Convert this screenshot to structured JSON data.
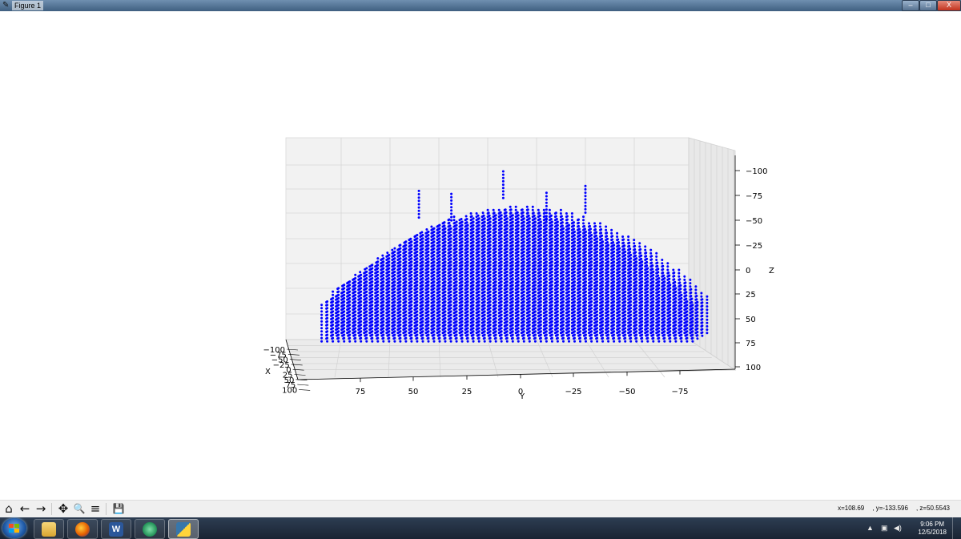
{
  "window": {
    "title": "Figure 1",
    "controls": {
      "minimize": "–",
      "maximize": "□",
      "close": "X"
    }
  },
  "chart_data": {
    "type": "scatter",
    "projection": "3d",
    "xlabel": "X",
    "ylabel": "Y",
    "zlabel": "Z",
    "x_ticks": [
      "−100",
      "−75",
      "−50",
      "−25",
      "0",
      "25",
      "50",
      "75",
      "100"
    ],
    "y_ticks": [
      "75",
      "50",
      "25",
      "0",
      "−25",
      "−50",
      "−75"
    ],
    "z_ticks": [
      "−100",
      "−75",
      "−50",
      "−25",
      "0",
      "25",
      "50",
      "75",
      "100"
    ],
    "xlim": [
      -100,
      100
    ],
    "ylim": [
      100,
      -100
    ],
    "zlim": [
      -100,
      100
    ],
    "z_axis_inverted": true,
    "grid": true,
    "marker_color": "#0000ff",
    "description": "dense grid of points forming a dome-shaped cloud; Y from about 90 to about -80, Z from about 75 up to about -100 at the peak"
  },
  "toolbar": {
    "buttons": [
      "home-icon",
      "back-icon",
      "forward-icon",
      "pan-icon",
      "zoom-icon",
      "configure-subplots-icon",
      "save-icon"
    ],
    "glyphs": [
      "⌂",
      "←",
      "→",
      "✥",
      "🔍",
      "≡",
      "💾"
    ],
    "coords": {
      "x": "x=108.69",
      "y": ", y=-133.596",
      "z": ", z=50.5543"
    }
  },
  "taskbar": {
    "apps": [
      "file-explorer",
      "firefox",
      "word",
      "atom",
      "python"
    ],
    "clock_time": "9:06 PM",
    "clock_date": "12/5/2018"
  }
}
